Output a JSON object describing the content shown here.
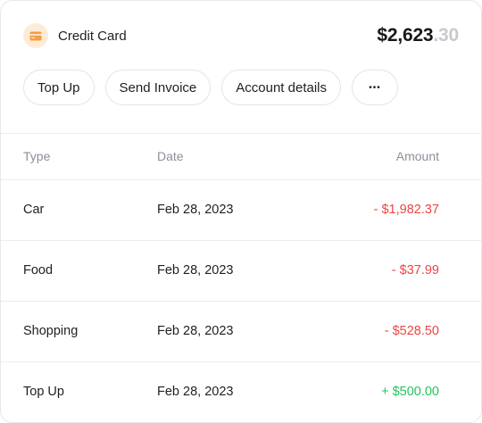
{
  "account": {
    "name": "Credit Card",
    "balance_whole": "$2,623",
    "balance_cents": ".30",
    "icon": "credit-card-icon",
    "accent_color": "#f59e42"
  },
  "actions": {
    "top_up": "Top Up",
    "send_invoice": "Send Invoice",
    "account_details": "Account details",
    "more": "•••"
  },
  "table": {
    "headers": {
      "type": "Type",
      "date": "Date",
      "amount": "Amount"
    },
    "rows": [
      {
        "type": "Car",
        "date": "Feb 28, 2023",
        "amount": "- $1,982.37",
        "direction": "debit"
      },
      {
        "type": "Food",
        "date": "Feb 28, 2023",
        "amount": "- $37.99",
        "direction": "debit"
      },
      {
        "type": "Shopping",
        "date": "Feb 28, 2023",
        "amount": "- $528.50",
        "direction": "debit"
      },
      {
        "type": "Top Up",
        "date": "Feb 28, 2023",
        "amount": "+ $500.00",
        "direction": "credit"
      }
    ]
  },
  "colors": {
    "debit": "#ef4444",
    "credit": "#22c55e"
  }
}
